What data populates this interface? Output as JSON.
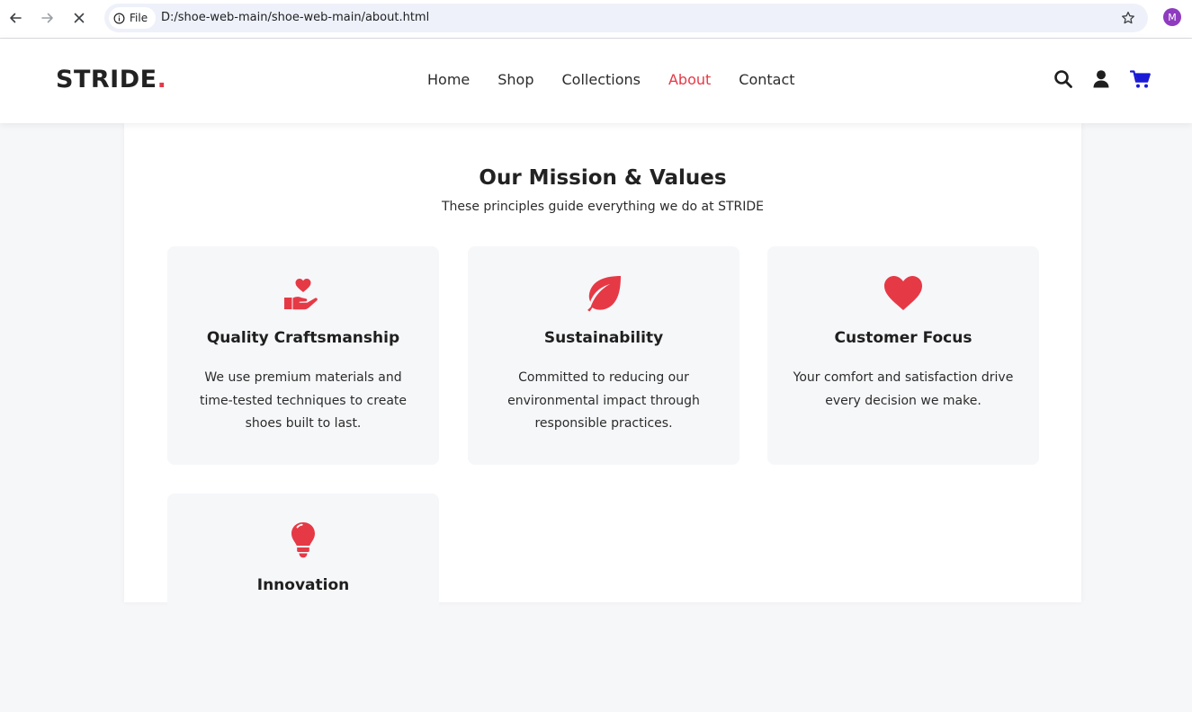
{
  "browser": {
    "url_scheme_label": "File",
    "url": "D:/shoe-web-main/shoe-web-main/about.html",
    "profile_initial": "M",
    "profile_color": "#8e3bbf",
    "icons": [
      "back-arrow-icon",
      "forward-arrow-icon",
      "stop-loading-icon",
      "info-icon",
      "bookmark-star-icon"
    ]
  },
  "header": {
    "brand": "STRIDE",
    "brand_dot": ".",
    "nav": [
      {
        "label": "Home",
        "active": false
      },
      {
        "label": "Shop",
        "active": false
      },
      {
        "label": "Collections",
        "active": false
      },
      {
        "label": "About",
        "active": true
      },
      {
        "label": "Contact",
        "active": false
      }
    ],
    "icons": [
      "search-icon",
      "user-icon",
      "cart-icon"
    ]
  },
  "values_section": {
    "title": "Our Mission & Values",
    "subtitle": "These principles guide everything we do at STRIDE",
    "cards": [
      {
        "icon": "hand-holding-heart-icon",
        "title": "Quality Craftsmanship",
        "text": "We use premium materials and time-tested techniques to create shoes built to last."
      },
      {
        "icon": "leaf-icon",
        "title": "Sustainability",
        "text": "Committed to reducing our environmental impact through responsible practices."
      },
      {
        "icon": "heart-icon",
        "title": "Customer Focus",
        "text": "Your comfort and satisfaction drive every decision we make."
      },
      {
        "icon": "lightbulb-icon",
        "title": "Innovation",
        "text": ""
      }
    ]
  },
  "colors": {
    "accent": "#e63946",
    "cart": "#1a1ad6",
    "page_background": "#f6f7f9",
    "card_background": "#f6f7f9",
    "text": "#222222"
  }
}
